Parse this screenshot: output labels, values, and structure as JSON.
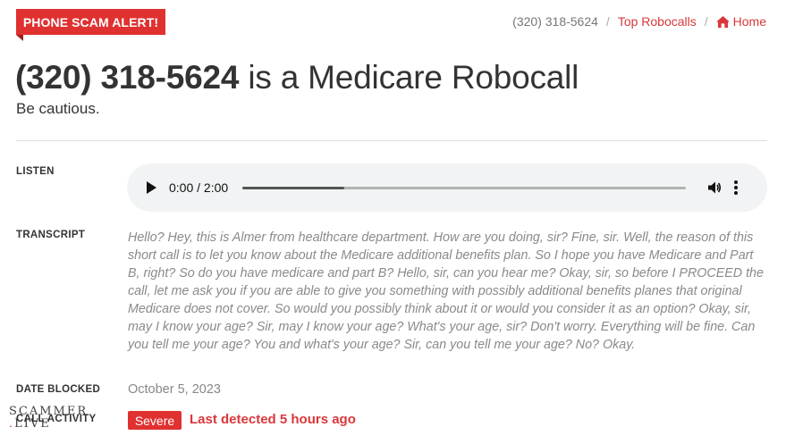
{
  "alert": {
    "label": "PHONE SCAM ALERT!"
  },
  "breadcrumb": {
    "number": "(320) 318-5624",
    "separator": "/",
    "top_robocalls": "Top Robocalls",
    "home": "Home"
  },
  "header": {
    "number": "(320) 318-5624",
    "title_rest": " is a Medicare Robocall",
    "subtitle": "Be cautious."
  },
  "listen": {
    "label": "LISTEN",
    "time": "0:00 / 2:00",
    "progress_fraction": 0.23
  },
  "transcript": {
    "label": "TRANSCRIPT",
    "text": "Hello? Hey, this is Almer from healthcare department. How are you doing, sir? Fine, sir. Well, the reason of this short call is to let you know about the Medicare additional benefits plan. So I hope you have Medicare and Part B, right? So do you have medicare and part B? Hello, sir, can you hear me? Okay, sir, so before I PROCEED the call, let me ask you if you are able to give you something with possibly additional benefits planes that original Medicare does not cover. So would you possibly think about it or would you consider it as an option? Okay, sir, may I know your age? Sir, may I know your age? What's your age, sir? Don't worry. Everything will be fine. Can you tell me your age? You and what's your age? Sir, can you tell me your age? No? Okay."
  },
  "date_blocked": {
    "label": "DATE BLOCKED",
    "value": "October 5, 2023"
  },
  "call_activity": {
    "label": "CALL ACTIVITY",
    "severity": "Severe",
    "last_detected": "Last detected 5 hours ago"
  },
  "watermark": {
    "line1": "SCAMMER",
    "line2_dot": ".",
    "line2": "LIVE"
  },
  "colors": {
    "accent_red": "#e03131",
    "link_red": "#d9383a",
    "player_bg": "#f1f3f4"
  },
  "icons": {
    "home": "home-icon",
    "play": "play-icon",
    "volume": "volume-icon",
    "menu": "more-vert-icon"
  }
}
